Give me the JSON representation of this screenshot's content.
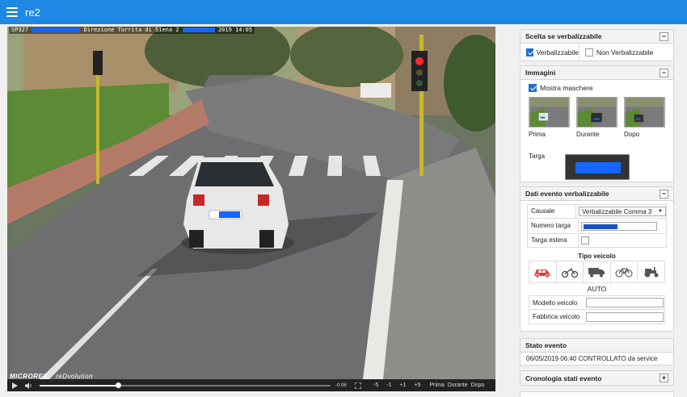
{
  "app": {
    "title": "re2"
  },
  "video": {
    "overlay_prefix": "SP327",
    "overlay_mid": "Direzione Torrita di Siena 2",
    "overlay_suffix": "2019 14:05",
    "brand": "MICROREX",
    "brand_sub": "reDvolution",
    "time": "-0:06",
    "progress_fraction": 0.27,
    "steps": [
      "-5",
      "-1",
      "+1",
      "+5"
    ],
    "segments": [
      "Prima",
      "Durante",
      "Dopo"
    ]
  },
  "scelta": {
    "title": "Scelta se verbalizzabile",
    "options": [
      {
        "label": "Verbalizzabile",
        "checked": true
      },
      {
        "label": "Non Verbalizzabile",
        "checked": false
      }
    ]
  },
  "immagini": {
    "title": "Immagini",
    "mostra_maschere": "Mostra maschere",
    "thumbs": [
      "Prima",
      "Durante",
      "Dopo"
    ],
    "targa_label": "Targa"
  },
  "dati": {
    "title": "Dati evento verbalizzabile",
    "causale_label": "Causale",
    "causale_value": "Verbalizzabile Comma 3",
    "numero_targa_label": "Numero targa",
    "targa_estera_label": "Targa estera",
    "tipo_veicolo_title": "Tipo veicolo",
    "vehicle_icons": [
      "car-icon",
      "motorcycle-icon",
      "truck-icon",
      "bicycle-icon",
      "tractor-icon"
    ],
    "selected_vehicle": "AUTO",
    "modello_label": "Modello veicolo",
    "fabbrica_label": "Fabbrica veicolo"
  },
  "stato": {
    "title": "Stato evento",
    "value": "06/05/2019 06:40 CONTROLLATO da service"
  },
  "cronologia": {
    "title": "Cronologia stati evento"
  },
  "colors": {
    "accent": "#1e88e5",
    "selected_vehicle": "#e53935",
    "redaction": "#1565ff"
  }
}
